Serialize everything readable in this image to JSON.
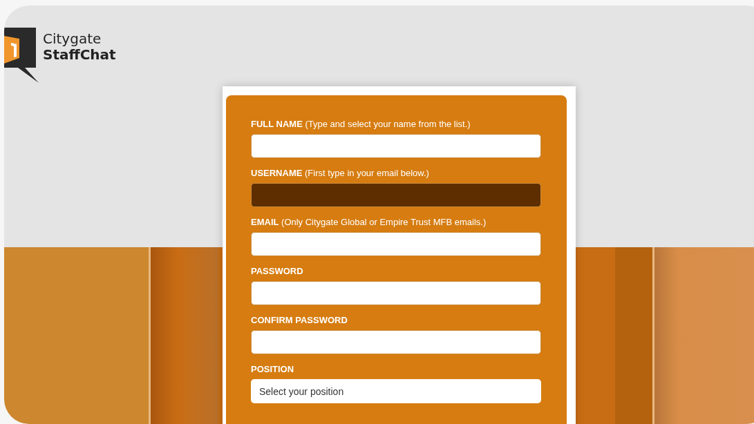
{
  "logo": {
    "line_1": "Citygate",
    "line_2": "StaffChat"
  },
  "form": {
    "fields": [
      {
        "kind": "text",
        "label": "**FULL NAME** (Type and select your name from the list.)",
        "disabled": false
      },
      {
        "kind": "text",
        "label": "**USERNAME** (First type in your email below.)",
        "disabled": true
      },
      {
        "kind": "text",
        "label": "**EMAIL** (Only Citygate Global or Empire Trust MFB emails.)",
        "disabled": false
      },
      {
        "kind": "text",
        "label": "**PASSWORD**",
        "disabled": false
      },
      {
        "kind": "text",
        "label": "**CONFIRM PASSWORD**",
        "disabled": false
      },
      {
        "kind": "select",
        "label": "**POSITION**",
        "placeholder": "Select your position",
        "disabled": false
      }
    ]
  }
}
